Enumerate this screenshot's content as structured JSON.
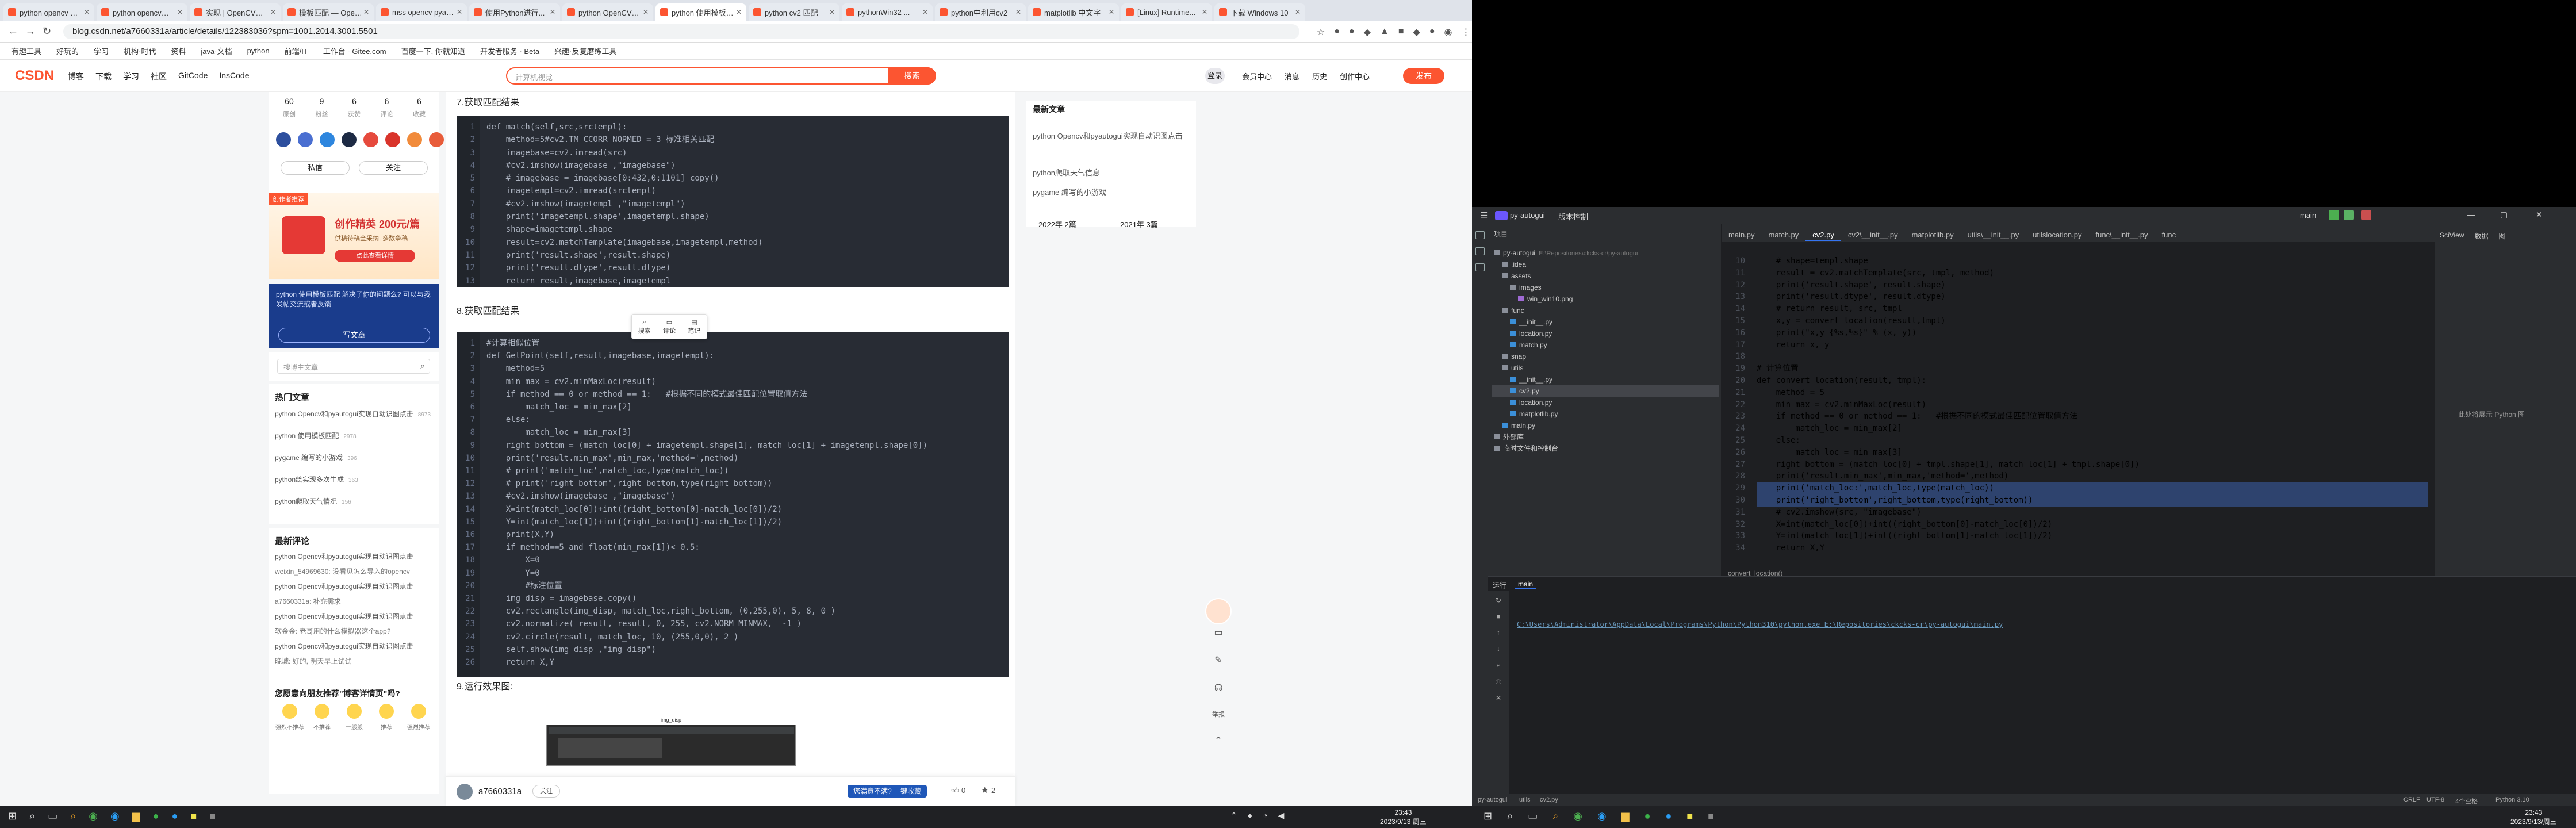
{
  "browser": {
    "tabs": [
      "python opencv 缺图 pyautogui",
      "python opencv自动化",
      "实现 | OpenCV图像",
      "模板匹配 — OpenCV",
      "mss opencv pyautogui",
      "使用Python进行...",
      "python OpenCV自动",
      "python 使用模板匹配",
      "python cv2 匹配",
      "pythonWin32 ...",
      "python中利用cv2",
      "matplotlib 中文字",
      "[Linux] Runtime...",
      "下载 Windows 10"
    ],
    "active_tab_index": 7,
    "url": "blog.csdn.net/a7660331a/article/details/122383036?spm=1001.2014.3001.5501",
    "bookmarks": [
      "有趣工具",
      "好玩的",
      "学习",
      "机构·时代",
      "资料",
      "java·文档",
      "python",
      "前端/IT",
      "工作台 - Gitee.com",
      "百度一下, 你就知道",
      "开发者服务 · Beta",
      "兴趣·反复磨练工具"
    ]
  },
  "csdn": {
    "logo": "CSDN",
    "nav": [
      "博客",
      "下载",
      "学习",
      "社区",
      "GitCode",
      "InsCode"
    ],
    "search_placeholder": "计算机视觉",
    "search_button": "搜索",
    "login": "登录",
    "right_nav": [
      "会员中心",
      "消息",
      "历史",
      "创作中心"
    ],
    "publish": "发布"
  },
  "sidebar": {
    "stats": [
      {
        "value": "60",
        "label": "原创"
      },
      {
        "value": "9",
        "label": "粉丝"
      },
      {
        "value": "6",
        "label": "获赞"
      },
      {
        "value": "6",
        "label": "评论"
      },
      {
        "value": "6",
        "label": "收藏"
      }
    ],
    "follow_buttons": [
      "私信",
      "关注"
    ],
    "promo_badge": "创作者推荐",
    "promo_title": "创作精英 200元/篇",
    "promo_sub": "供稿待稿全采纳, 多数争稿",
    "promo_button": "点此查看详情",
    "ai_text": "python 使用模板匹配 解决了你的问题么? 可以与我发帖交流或者反馈",
    "ai_button": "写文章",
    "search_placeholder": "搜博主文章",
    "hot_title": "热门文章",
    "hot_articles": [
      {
        "title": "python Opencv和pyautogui实现自动识图点击",
        "views": "8973"
      },
      {
        "title": "python 使用模板匹配",
        "views": "2978"
      },
      {
        "title": "pygame 编写的小游戏",
        "views": "396"
      },
      {
        "title": "python绘实现多次生成",
        "views": "363"
      },
      {
        "title": "python爬取天气情况",
        "views": "156"
      }
    ],
    "recent_comments_title": "最新评论",
    "recent_comments": [
      "python Opencv和pyautogui实现自动识图点击",
      "weixin_54969630: 没看见怎么导入的opencv",
      "python Opencv和pyautogui实现自动识图点击",
      "a7660331a: 补充需求",
      "python Opencv和pyautogui实现自动识图点击",
      "软金金: 老哥用的什么模拟器这个app?",
      "python Opencv和pyautogui实现自动识图点击",
      "晚城: 好的, 明天早上试试"
    ],
    "rating_title": "您愿意向朋友推荐\"博客详情页\"吗?",
    "rating_labels": [
      "强烈不推荐",
      "不推荐",
      "一般般",
      "推荐",
      "强烈推荐"
    ]
  },
  "article": {
    "heading7": "7.获取匹配结果",
    "heading8": "8.获取匹配结果",
    "heading9": "9.运行效果图:",
    "code1": [
      "def match(self,src,srctempl):",
      "    method=5#cv2.TM_CCORR_NORMED = 3 标准相关匹配",
      "    imagebase=cv2.imread(src)",
      "    #cv2.imshow(imagebase ,\"imagebase\")",
      "    # imagebase = imagebase[0:432,0:1101] copy()",
      "    imagetempl=cv2.imread(srctempl)",
      "    #cv2.imshow(imagetempl ,\"imagetempl\")",
      "    print('imagetempl.shape',imagetempl.shape)",
      "    shape=imagetempl.shape",
      "    result=cv2.matchTemplate(imagebase,imagetempl,method)",
      "    print('result.shape',result.shape)",
      "    print('result.dtype',result.dtype)",
      "    return result,imagebase,imagetempl"
    ],
    "code2": [
      "#计算相似位置",
      "def GetPoint(self,result,imagebase,imagetempl):",
      "    method=5",
      "    min_max = cv2.minMaxLoc(result)",
      "    if method == 0 or method == 1:   #根据不同的模式最佳匹配位置取值方法",
      "        match_loc = min_max[2]",
      "    else:",
      "        match_loc = min_max[3]",
      "    right_bottom = (match_loc[0] + imagetempl.shape[1], match_loc[1] + imagetempl.shape[0])",
      "    print('result.min_max',min_max,'method=',method)",
      "    # print('match_loc',match_loc,type(match_loc))",
      "    # print('right_bottom',right_bottom,type(right_bottom))",
      "    #cv2.imshow(imagebase ,\"imagebase\")",
      "    X=int(match_loc[0])+int((right_bottom[0]-match_loc[0])/2)",
      "    Y=int(match_loc[1])+int((right_bottom[1]-match_loc[1])/2)",
      "    print(X,Y)",
      "    if method==5 and float(min_max[1])< 0.5:",
      "        X=0",
      "        Y=0",
      "        #标注位置",
      "    img_disp = imagebase.copy()",
      "    cv2.rectangle(img_disp, match_loc,right_bottom, (0,255,0), 5, 8, 0 )",
      "    cv2.normalize( result, result, 0, 255, cv2.NORM_MINMAX,  -1 )",
      "    cv2.circle(result, match_loc, 10, (255,0,0), 2 )",
      "    self.show(img_disp ,\"img_disp\")",
      "    return X,Y"
    ],
    "selection_toolbar": [
      "搜索",
      "评论",
      "笔记"
    ],
    "screenshot_caption": "img_disp",
    "author": "a7660331a",
    "author_follow": "关注",
    "like_count": "0",
    "fav_count": "2",
    "comment_count": "0",
    "unsatisfied": "您满意不满? 一键收藏",
    "right_col_title": "最新文章",
    "right_col_items": [
      "python Opencv和pyautogui实现自动识图点击",
      "python爬取天气信息",
      "pygame 编写的小游戏"
    ],
    "archive": [
      "2022年 2篇",
      "2021年 3篇"
    ],
    "float_tools": [
      "客服",
      "举报",
      "返回顶部"
    ]
  },
  "ide": {
    "project": "py-autogui",
    "vcs": "版本控制",
    "run_config": "main",
    "file_tabs": [
      "main.py",
      "match.py",
      "cv2.py",
      "cv2\\__init__.py",
      "matplotlib.py",
      "utils\\__init__.py",
      "utilslocation.py",
      "func\\__init__.py",
      "func"
    ],
    "active_file": "cv2.py",
    "project_label": "项目",
    "tree": [
      {
        "name": "py-autogui",
        "note": "E:\\Repositories\\ckcks-cr\\py-autogui",
        "depth": 0
      },
      {
        "name": ".idea",
        "depth": 1
      },
      {
        "name": "assets",
        "depth": 1
      },
      {
        "name": "images",
        "depth": 2
      },
      {
        "name": "win_win10.png",
        "depth": 3
      },
      {
        "name": "func",
        "depth": 1
      },
      {
        "name": "__init__.py",
        "depth": 2
      },
      {
        "name": "location.py",
        "depth": 2
      },
      {
        "name": "match.py",
        "depth": 2
      },
      {
        "name": "snap",
        "depth": 1
      },
      {
        "name": "utils",
        "depth": 1
      },
      {
        "name": "__init__.py",
        "depth": 2
      },
      {
        "name": "cv2.py",
        "depth": 2
      },
      {
        "name": "location.py",
        "depth": 2
      },
      {
        "name": "matplotlib.py",
        "depth": 2
      },
      {
        "name": "main.py",
        "depth": 1
      },
      {
        "name": "外部库",
        "depth": 0
      },
      {
        "name": "临时文件和控制台",
        "depth": 0
      }
    ],
    "gutter_start": 10,
    "code": [
      "    # shape=templ.shape",
      "    result = cv2.matchTemplate(src, tmpl, method)",
      "    print('result.shape', result.shape)",
      "    print('result.dtype', result.dtype)",
      "    # return result, src, tmpl",
      "    x,y = convert_location(result,tmpl)",
      "    print(\"x,y {%s,%s}\" % (x, y))",
      "    return x, y",
      "",
      "# 计算位置",
      "def convert_location(result, tmpl):",
      "    method = 5",
      "    min_max = cv2.minMaxLoc(result)",
      "    if method == 0 or method == 1:   #根据不同的模式最佳匹配位置取值方法",
      "        match_loc = min_max[2]",
      "    else:",
      "        match_loc = min_max[3]",
      "    right_bottom = (match_loc[0] + tmpl.shape[1], match_loc[1] + tmpl.shape[0])",
      "    print('result.min_max',min_max,'method=',method)",
      "    print('match_loc:',match_loc,type(match_loc))",
      "    print('right_bottom',right_bottom,type(right_bottom))",
      "    # cv2.imshow(src, \"imagebase\")",
      "    X=int(match_loc[0])+int((right_bottom[0]-match_loc[0])/2)",
      "    Y=int(match_loc[1])+int((right_bottom[1]-match_loc[1])/2)",
      "    return X,Y"
    ],
    "breadcrumb_bottom": "convert_location()",
    "sciview_tabs": [
      "SciView",
      "数据",
      "图"
    ],
    "sciview_empty": "此处将展示 Python 图",
    "run_title": "运行",
    "run_tab": "main",
    "run_command": "C:\\Users\\Administrator\\AppData\\Local\\Programs\\Python\\Python310\\python.exe E:\\Repositories\\ckcks-cr\\py-autogui\\main.py",
    "status_path": [
      "py-autogui",
      "utils",
      "cv2.py"
    ],
    "status_right": [
      "CRLF",
      "UTF-8",
      "4个空格",
      "Python 3.10"
    ]
  },
  "taskbar": {
    "time": "23:43",
    "date": "2023/9/13 周三",
    "time2": "23:43",
    "date2": "2023/9/13/周三"
  }
}
